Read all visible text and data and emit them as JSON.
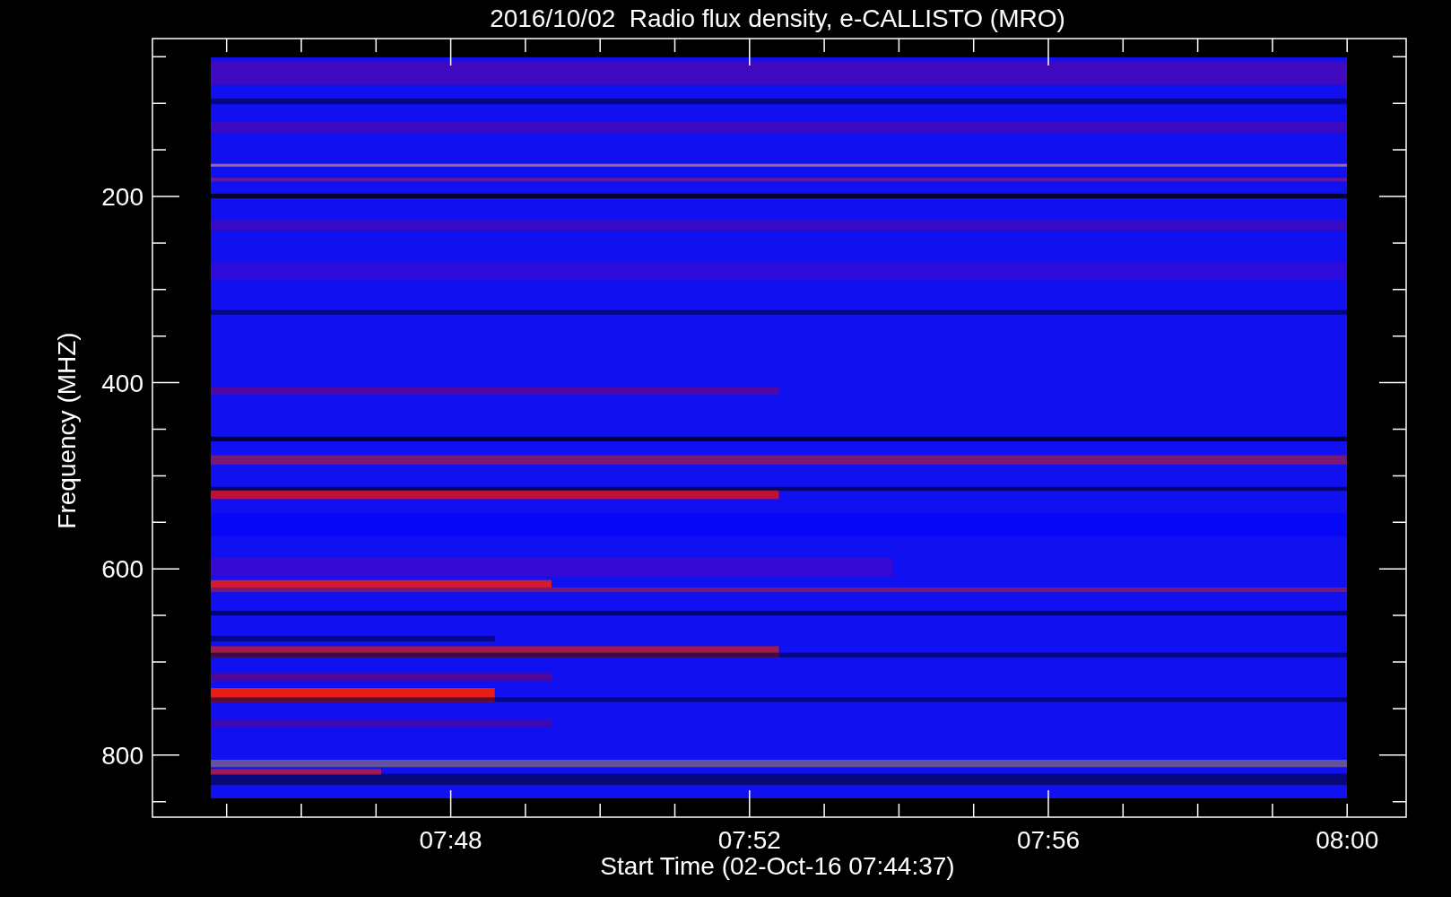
{
  "title": "2016/10/02  Radio flux density, e-CALLISTO (MRO)",
  "plot": {
    "y_axis": {
      "label": "Frequency (MHZ)",
      "ticks": [
        "200",
        "400",
        "600",
        "800"
      ]
    },
    "x_axis": {
      "label": "Start Time (02-Oct-16 07:44:37)",
      "ticks": [
        "07:48",
        "07:52",
        "07:56",
        "08:00"
      ]
    }
  }
}
